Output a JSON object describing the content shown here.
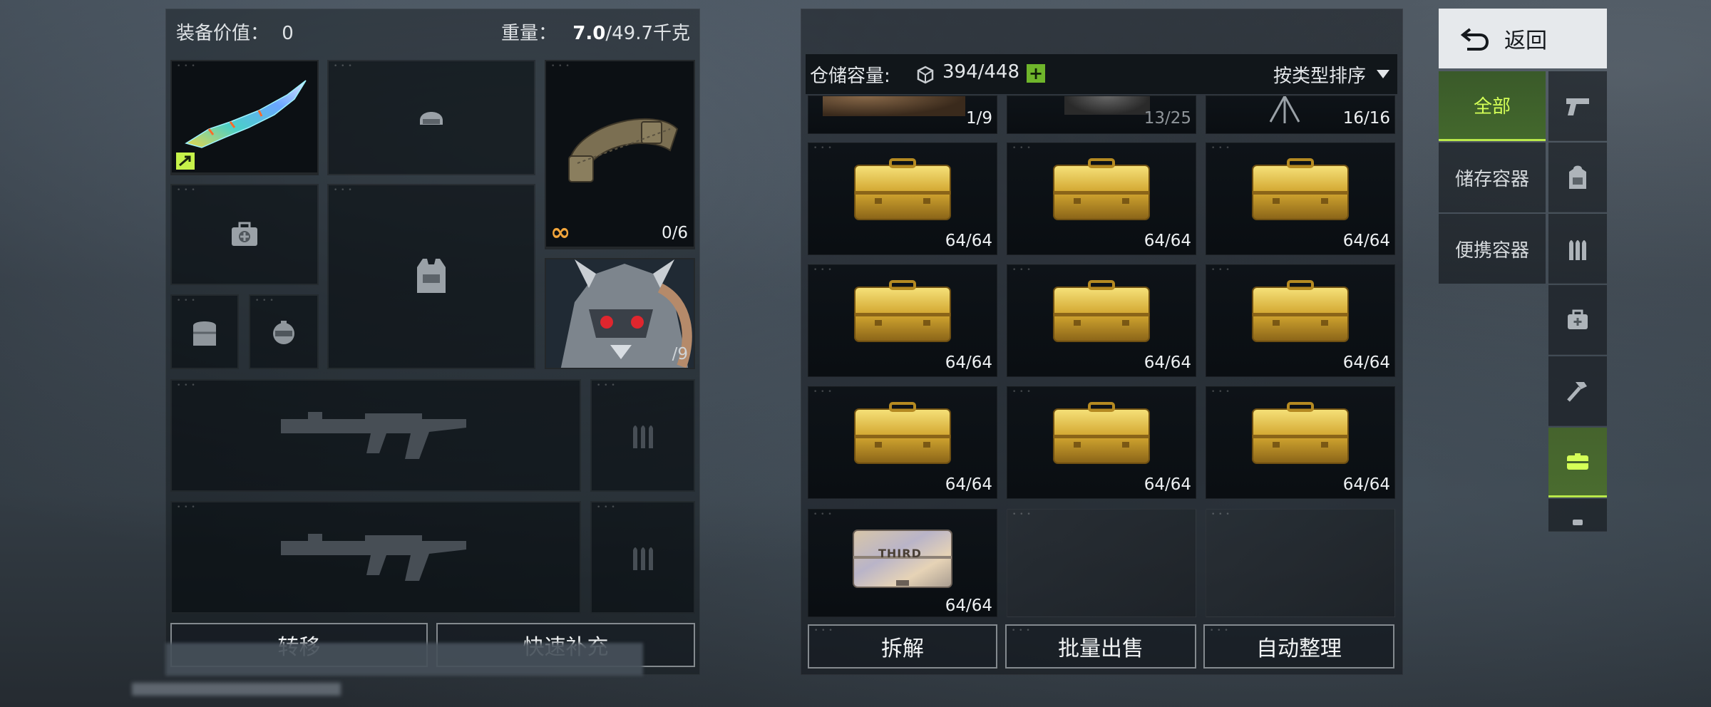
{
  "loadout": {
    "value_label": "装备价值：",
    "value": "0",
    "weight_label": "重量：",
    "weight_current": "7.0",
    "weight_max": "/49.7千克",
    "slots": {
      "melee": {
        "icon": "blade-weapon-icon",
        "badge_icon": "transfer-badge-icon"
      },
      "helmet": {
        "icon": "helmet-icon"
      },
      "belt": {
        "icon": "tactical-belt-icon",
        "infinity": "∞",
        "count": "0/6"
      },
      "medkit": {
        "icon": "medkit-icon"
      },
      "vest": {
        "icon": "vest-icon"
      },
      "small_1": {
        "icon": "armor-icon"
      },
      "small_2": {
        "icon": "grenade-icon"
      },
      "character": {
        "icon": "character-portrait-icon",
        "count": "/9"
      },
      "primary": {
        "icon": "rifle-icon"
      },
      "primary_ammo": {
        "icon": "ammo-icon"
      },
      "secondary": {
        "icon": "rifle-icon"
      },
      "secondary_ammo": {
        "icon": "ammo-icon"
      }
    },
    "transfer_label": "转移",
    "quick_refill_label": "快速补充"
  },
  "storage": {
    "capacity_label": "仓储容量:",
    "capacity_icon": "storage-cube-icon",
    "capacity_value": "394/448",
    "add_icon": "plus-icon",
    "sort_label": "按类型排序",
    "top_row": [
      {
        "count": "1/9",
        "rarity": "purple"
      },
      {
        "count": "13/25",
        "rarity": "red"
      },
      {
        "count": "16/16",
        "rarity": "gold"
      }
    ],
    "cells": [
      {
        "count": "64/64",
        "icon": "gold-case-icon"
      },
      {
        "count": "64/64",
        "icon": "gold-case-icon"
      },
      {
        "count": "64/64",
        "icon": "gold-case-icon"
      },
      {
        "count": "64/64",
        "icon": "gold-case-icon"
      },
      {
        "count": "64/64",
        "icon": "gold-case-icon"
      },
      {
        "count": "64/64",
        "icon": "gold-case-icon"
      },
      {
        "count": "64/64",
        "icon": "gold-case-icon"
      },
      {
        "count": "64/64",
        "icon": "gold-case-icon"
      },
      {
        "count": "64/64",
        "icon": "gold-case-icon"
      }
    ],
    "special_cell": {
      "count": "64/64",
      "icon": "third-case-icon",
      "case_text": "THIRD"
    },
    "dismantle_label": "拆解",
    "bulk_sell_label": "批量出售",
    "auto_sort_label": "自动整理"
  },
  "nav": {
    "back_label": "返回",
    "tabs": [
      {
        "label": "全部",
        "active": true
      },
      {
        "label": "储存容器",
        "active": false
      },
      {
        "label": "便携容器",
        "active": false
      }
    ],
    "category_icons": [
      {
        "icon": "pistol-icon",
        "active": false
      },
      {
        "icon": "backpack-icon",
        "active": false
      },
      {
        "icon": "ammo-icon",
        "active": false
      },
      {
        "icon": "medkit-icon",
        "active": false
      },
      {
        "icon": "hammer-icon",
        "active": false
      },
      {
        "icon": "container-icon",
        "active": true
      }
    ]
  },
  "colors": {
    "accent_green": "#b9e84a",
    "rarity_gold": "#e8952a",
    "rarity_purple": "#c34fe0",
    "rarity_red": "#b84547"
  }
}
